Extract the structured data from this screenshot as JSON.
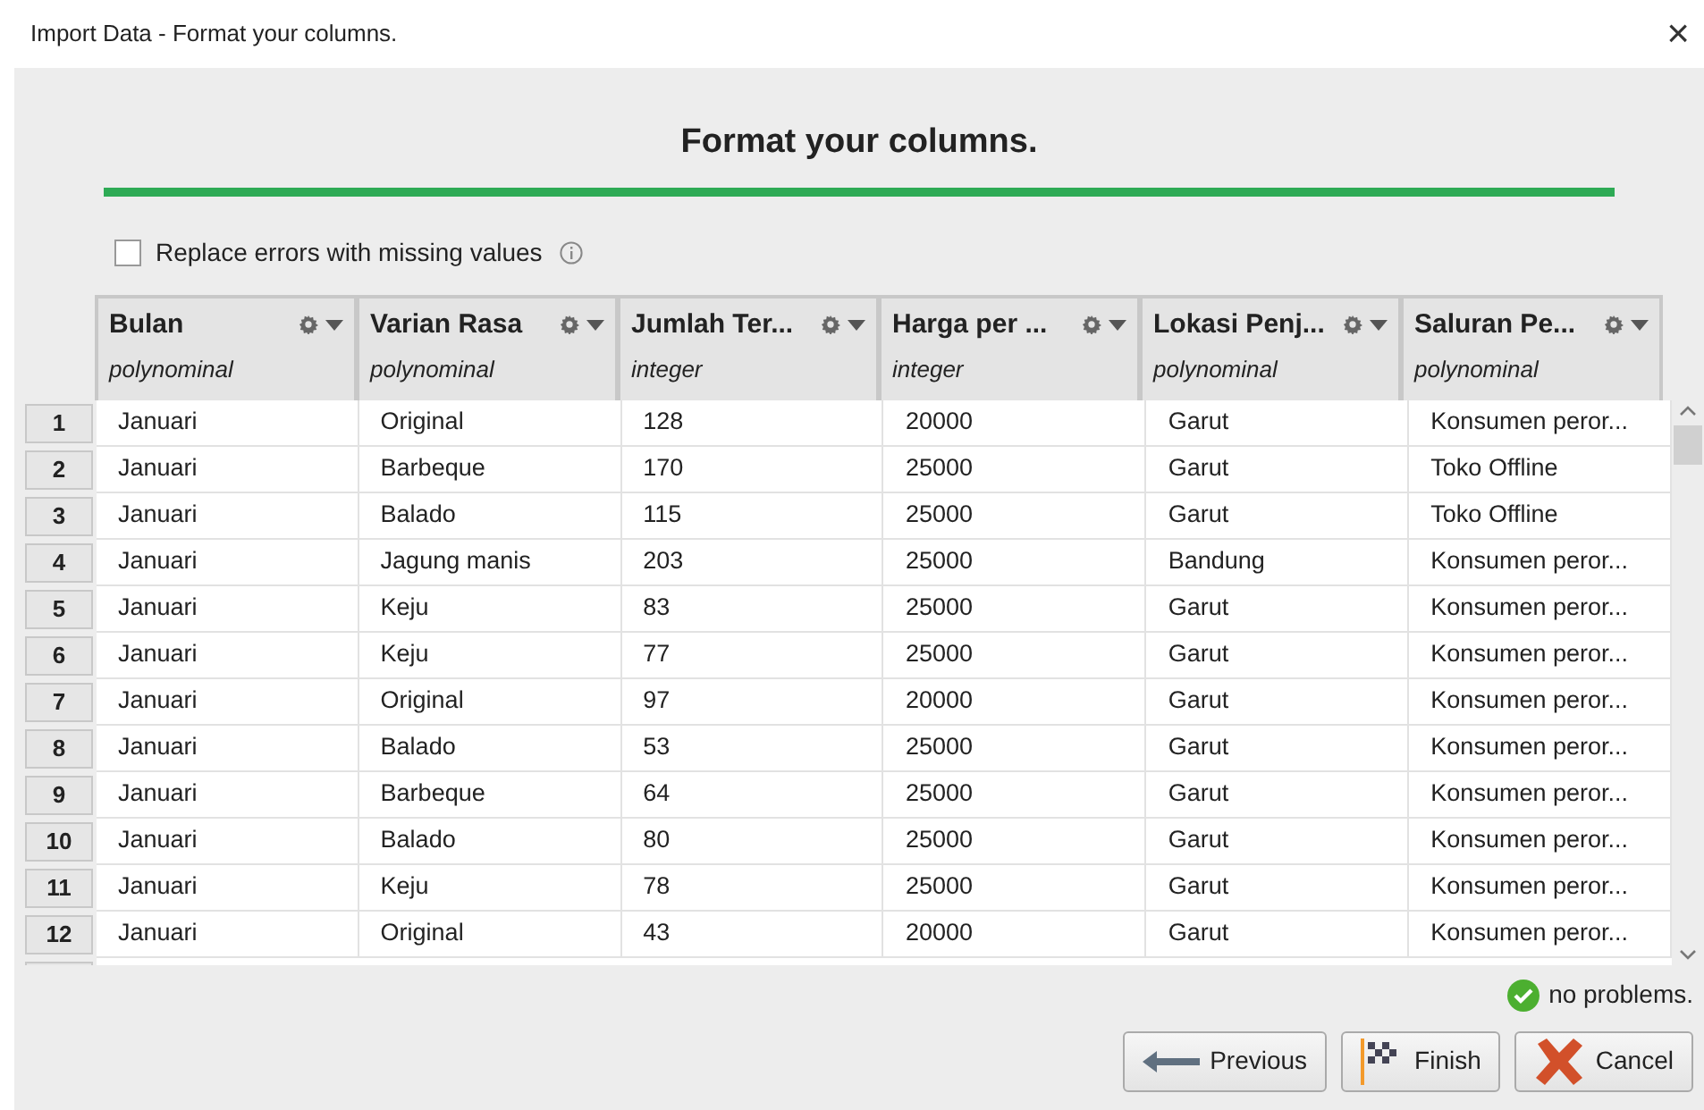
{
  "window": {
    "title": "Import Data - Format your columns.",
    "close": "×"
  },
  "heading": "Format your columns.",
  "replace_errors": {
    "label": "Replace errors with missing values",
    "checked": false
  },
  "table": {
    "columns": [
      {
        "name": "Bulan",
        "type": "polynominal"
      },
      {
        "name": "Varian Rasa",
        "type": "polynominal"
      },
      {
        "name": "Jumlah Ter...",
        "type": "integer"
      },
      {
        "name": "Harga per ...",
        "type": "integer"
      },
      {
        "name": "Lokasi Penj...",
        "type": "polynominal"
      },
      {
        "name": "Saluran Pe...",
        "type": "polynominal"
      }
    ],
    "rows": [
      {
        "index": "1",
        "cells": [
          "Januari",
          "Original",
          "128",
          "20000",
          "Garut",
          "Konsumen peror..."
        ]
      },
      {
        "index": "2",
        "cells": [
          "Januari",
          "Barbeque",
          "170",
          "25000",
          "Garut",
          "Toko Offline"
        ]
      },
      {
        "index": "3",
        "cells": [
          "Januari",
          "Balado",
          "115",
          "25000",
          "Garut",
          "Toko Offline"
        ]
      },
      {
        "index": "4",
        "cells": [
          "Januari",
          "Jagung manis",
          "203",
          "25000",
          "Bandung",
          "Konsumen peror..."
        ]
      },
      {
        "index": "5",
        "cells": [
          "Januari",
          "Keju",
          "83",
          "25000",
          "Garut",
          "Konsumen peror..."
        ]
      },
      {
        "index": "6",
        "cells": [
          "Januari",
          "Keju",
          "77",
          "25000",
          "Garut",
          "Konsumen peror..."
        ]
      },
      {
        "index": "7",
        "cells": [
          "Januari",
          "Original",
          "97",
          "20000",
          "Garut",
          "Konsumen peror..."
        ]
      },
      {
        "index": "8",
        "cells": [
          "Januari",
          "Balado",
          "53",
          "25000",
          "Garut",
          "Konsumen peror..."
        ]
      },
      {
        "index": "9",
        "cells": [
          "Januari",
          "Barbeque",
          "64",
          "25000",
          "Garut",
          "Konsumen peror..."
        ]
      },
      {
        "index": "10",
        "cells": [
          "Januari",
          "Balado",
          "80",
          "25000",
          "Garut",
          "Konsumen peror..."
        ]
      },
      {
        "index": "11",
        "cells": [
          "Januari",
          "Keju",
          "78",
          "25000",
          "Garut",
          "Konsumen peror..."
        ]
      },
      {
        "index": "12",
        "cells": [
          "Januari",
          "Original",
          "43",
          "20000",
          "Garut",
          "Konsumen peror..."
        ]
      }
    ]
  },
  "status": "no problems.",
  "buttons": [
    {
      "kind": "previous",
      "label": "Previous"
    },
    {
      "kind": "finish",
      "label": "Finish"
    },
    {
      "kind": "cancel",
      "label": "Cancel"
    }
  ]
}
